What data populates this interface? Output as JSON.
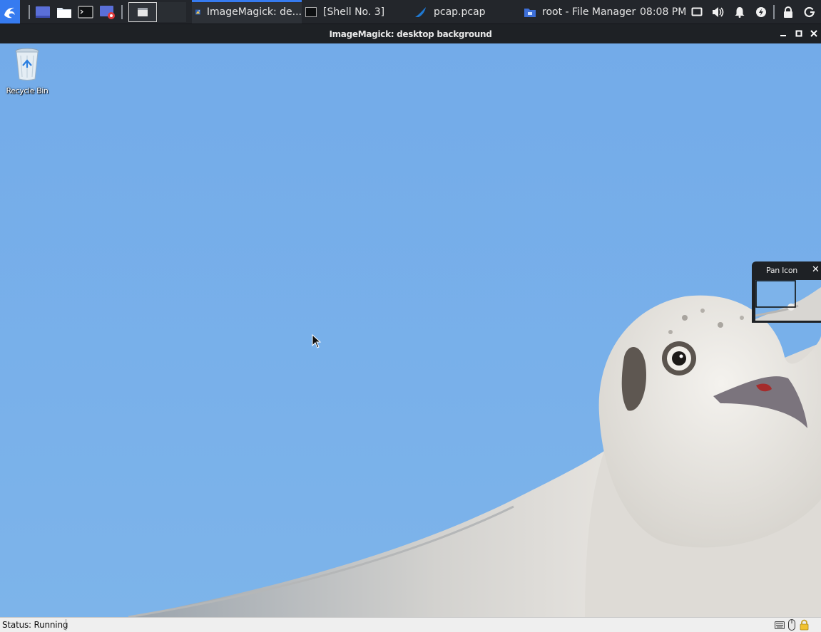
{
  "panel": {
    "launchers": [
      "kali-menu-icon",
      "desktop-icon",
      "file-manager-icon",
      "terminal-icon",
      "screen-recorder-icon"
    ],
    "tasks": [
      {
        "label": "ImageMagick: de...",
        "icon": "imagemagick-icon",
        "active": true
      },
      {
        "label": "[Shell No. 3]",
        "icon": "terminal-icon",
        "active": false
      },
      {
        "label": "pcap.pcap",
        "icon": "wireshark-icon",
        "active": false
      },
      {
        "label": "root - File Manager",
        "icon": "folder-icon",
        "active": false
      }
    ],
    "clock": "08:08 PM",
    "tray": [
      "display-icon",
      "volume-icon",
      "notification-icon",
      "power-icon",
      "lock-icon",
      "logout-icon"
    ]
  },
  "window": {
    "title": "ImageMagick: desktop background",
    "controls": [
      "minimize",
      "maximize",
      "close"
    ]
  },
  "desktop": {
    "icons": [
      {
        "label": "Recycle Bin",
        "icon": "recycle-bin-icon"
      }
    ]
  },
  "pan_window": {
    "title": "Pan Icon",
    "close": "✕"
  },
  "status_bar": {
    "status": "Status: Running",
    "tray": [
      "keyboard-icon",
      "mouse-icon",
      "lock-icon"
    ]
  },
  "colors": {
    "sky": "#7cb1ea",
    "panel_bg": "#23262b",
    "accent": "#367bf0"
  }
}
